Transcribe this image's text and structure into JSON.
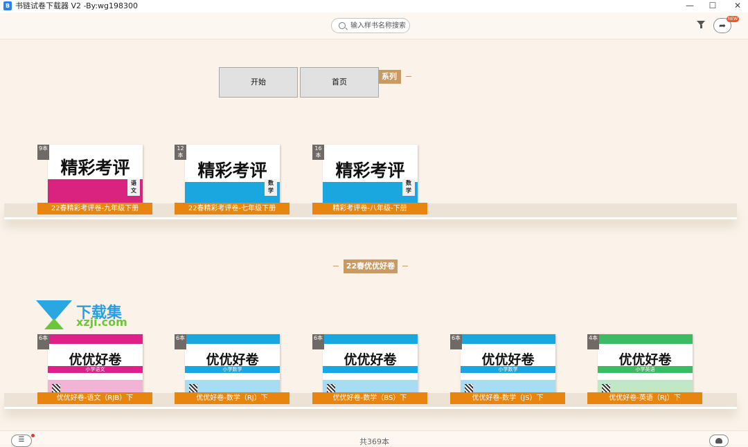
{
  "window": {
    "title": "书链试卷下载器 V2 -By:wg198300",
    "minimize": "—",
    "maximize": "☐",
    "close": "✕"
  },
  "toolbar": {
    "search_placeholder": "输入样书名称搜索",
    "filter_icon": "filter-icon",
    "share_icon": "share-icon",
    "badge": "NEW"
  },
  "overlay": {
    "start_label": "开始",
    "home_label": "首页"
  },
  "sections": [
    {
      "title": "精彩考评系列",
      "title_visible": "系列",
      "books": [
        {
          "count": "9本",
          "label": "22春精彩考评卷-九年级下册",
          "cover_title": "精彩考评",
          "subject": "语文",
          "color": "#d9237f"
        },
        {
          "count": "12本",
          "label": "22春精彩考评卷-七年级下册",
          "cover_title": "精彩考评",
          "subject": "数学",
          "color": "#1aa7e0"
        },
        {
          "count": "16本",
          "label": "精彩考评卷-八年级-下册",
          "cover_title": "精彩考评",
          "subject": "数学",
          "color": "#1aa7e0"
        }
      ]
    },
    {
      "title": "22春优优好卷",
      "books": [
        {
          "count": "6本",
          "label": "优优好卷-语文（RJB）下",
          "cover_title": "优优好卷",
          "subject": "小学语文",
          "color": "#e0208a"
        },
        {
          "count": "6本",
          "label": "优优好卷-数学（RJ）下",
          "cover_title": "优优好卷",
          "subject": "小学数学",
          "color": "#1aa7e0"
        },
        {
          "count": "6本",
          "label": "优优好卷-数学（BS）下",
          "cover_title": "优优好卷",
          "subject": "",
          "color": "#1aa7e0"
        },
        {
          "count": "6本",
          "label": "优优好卷-数学（JS）下",
          "cover_title": "优优好卷",
          "subject": "小学数学",
          "color": "#1aa7e0"
        },
        {
          "count": "4本",
          "label": "优优好卷-英语（RJ）下",
          "cover_title": "优优好卷",
          "subject": "小学英语",
          "color": "#3cbb64"
        }
      ]
    }
  ],
  "watermark": {
    "cn": "下载集",
    "en": "xzji.com"
  },
  "bottom": {
    "total": "共369本",
    "list_icon": "list-icon",
    "right_icon": "bag-icon"
  }
}
